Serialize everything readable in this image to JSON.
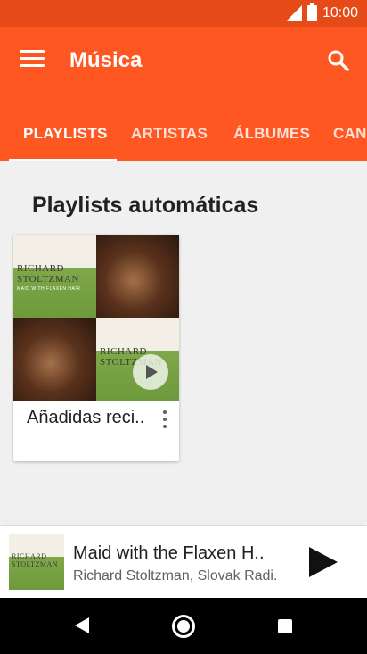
{
  "status_bar": {
    "time": "10:00"
  },
  "app_bar": {
    "title": "Música"
  },
  "tabs": [
    {
      "label": "PLAYLISTS",
      "active": true
    },
    {
      "label": "ARTISTAS",
      "active": false
    },
    {
      "label": "ÁLBUMES",
      "active": false
    },
    {
      "label": "CANCIONES",
      "active": false
    }
  ],
  "section": {
    "title": "Playlists automáticas",
    "cards": [
      {
        "label": "Añadidas reci..",
        "cover_text": "RICHARD STOLTZMAN",
        "cover_subtext": "MAID WITH FLAXEN HAIR"
      }
    ]
  },
  "now_playing": {
    "title": "Maid with the Flaxen H..",
    "artist": "Richard Stoltzman, Slovak Radi..",
    "cover_text": "RICHARD STOLTZMAN"
  },
  "colors": {
    "status_bar": "#e64a19",
    "app_bar": "#ff5722",
    "accent_text": "#ffffff"
  },
  "icons": {
    "menu": "menu-icon",
    "search": "search-icon",
    "more": "more-vert-icon",
    "play": "play-icon",
    "back": "back-icon",
    "home": "home-icon",
    "recents": "recents-icon"
  }
}
